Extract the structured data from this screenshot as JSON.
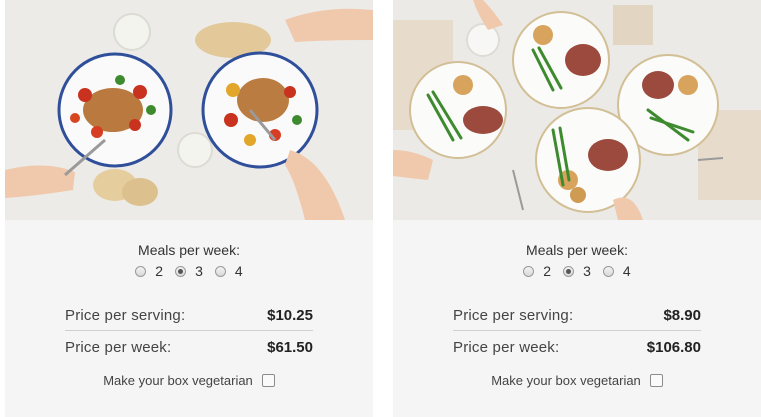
{
  "plans": [
    {
      "image_alt": "Pork chops with roasted tomatoes and peppers",
      "meals_label": "Meals per week:",
      "meal_options": [
        "2",
        "3",
        "4"
      ],
      "selected_meals": "3",
      "serving_label": "Price per serving:",
      "serving_price": "$10.25",
      "week_label": "Price per week:",
      "week_price": "$61.50",
      "vegetarian_label": "Make your box vegetarian",
      "vegetarian_checked": false
    },
    {
      "image_alt": "Sliced steak with green beans and roasted potatoes",
      "meals_label": "Meals per week:",
      "meal_options": [
        "2",
        "3",
        "4"
      ],
      "selected_meals": "3",
      "serving_label": "Price per serving:",
      "serving_price": "$8.90",
      "week_label": "Price per week:",
      "week_price": "$106.80",
      "vegetarian_label": "Make your box vegetarian",
      "vegetarian_checked": false
    }
  ],
  "colors": {
    "card_bg": "#f5f5f5",
    "plate_rim": "#2f4f9a",
    "tomato": "#c8321e",
    "green_bean": "#3d8b2e"
  }
}
